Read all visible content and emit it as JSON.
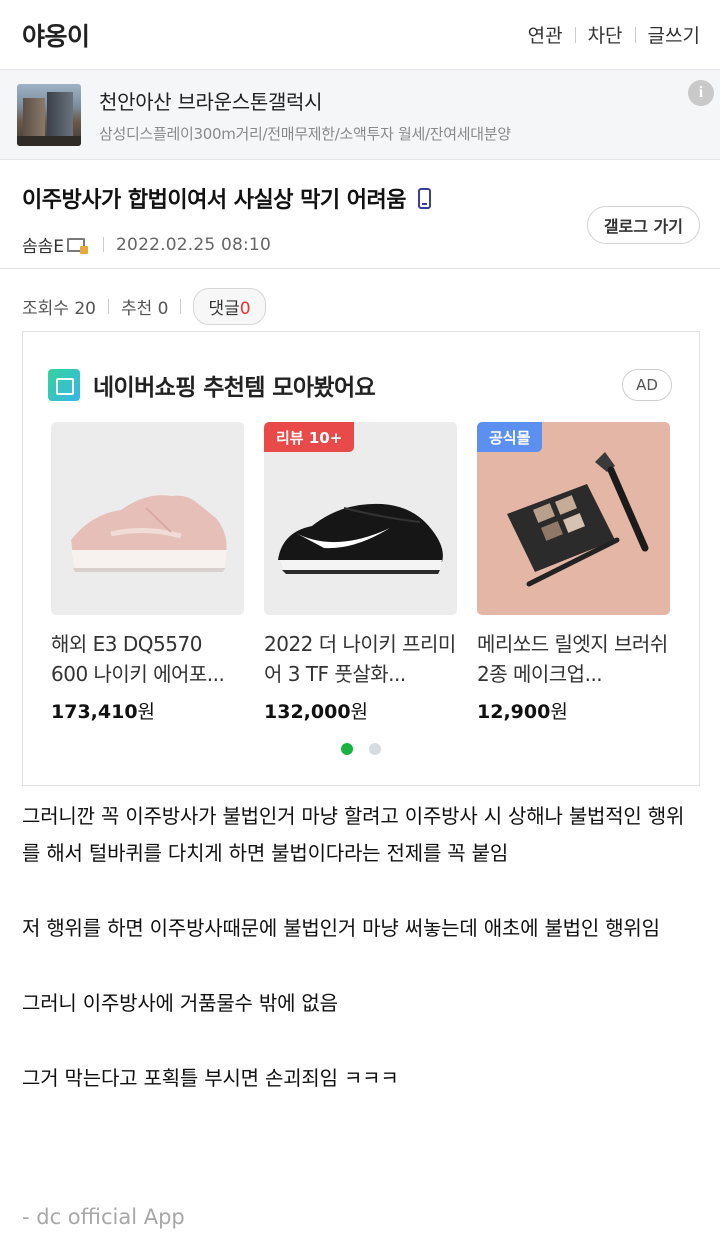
{
  "header": {
    "gallery_title": "야옹이",
    "actions": [
      "연관",
      "차단",
      "글쓰기"
    ]
  },
  "banner": {
    "title": "천안아산 브라운스톤갤럭시",
    "subtitle": "삼성디스플레이300m거리/전매무제한/소액투자 월세/잔여세대분양",
    "info": "i"
  },
  "post": {
    "title": "이주방사가 합법이여서 사실상 막기 어려움",
    "writer": "솜솜E",
    "date": "2022.02.25 08:10",
    "gallery_button": "갤로그 가기"
  },
  "stats": {
    "views_label": "조회수 20",
    "recommend_label": "추천 0",
    "comment_label": "댓글",
    "comment_count": "0"
  },
  "shopping": {
    "title": "네이버쇼핑 추천템 모아봤어요",
    "ad_label": "AD",
    "products": [
      {
        "tag": "",
        "name": "해외 E3 DQ5570 600 나이키 에어포...",
        "price": "173,410",
        "currency": "원"
      },
      {
        "tag": "리뷰 10+",
        "name": "2022 더 나이키 프리미어 3 TF 풋살화...",
        "price": "132,000",
        "currency": "원"
      },
      {
        "tag": "공식몰",
        "name": "메리쏘드 릴엣지 브러쉬 2종 메이크업...",
        "price": "12,900",
        "currency": "원"
      }
    ],
    "tag_colors": {
      "review": "#e84a4a",
      "official": "#5b8ff0"
    }
  },
  "content": {
    "paragraphs": [
      "그러니깐 꼭 이주방사가 불법인거 마냥 할려고 이주방사 시 상해나 불법적인 행위를 해서 털바퀴를 다치게 하면 불법이다라는 전제를 꼭 붙임",
      "저 행위를 하면 이주방사때문에 불법인거 마냥 써놓는데 애초에 불법인 행위임",
      "그러니 이주방사에 거품물수 밖에 없음",
      "그거 막는다고 포획틀 부시면 손괴죄임 ㅋㅋㅋ"
    ],
    "signature": "- dc official App"
  }
}
